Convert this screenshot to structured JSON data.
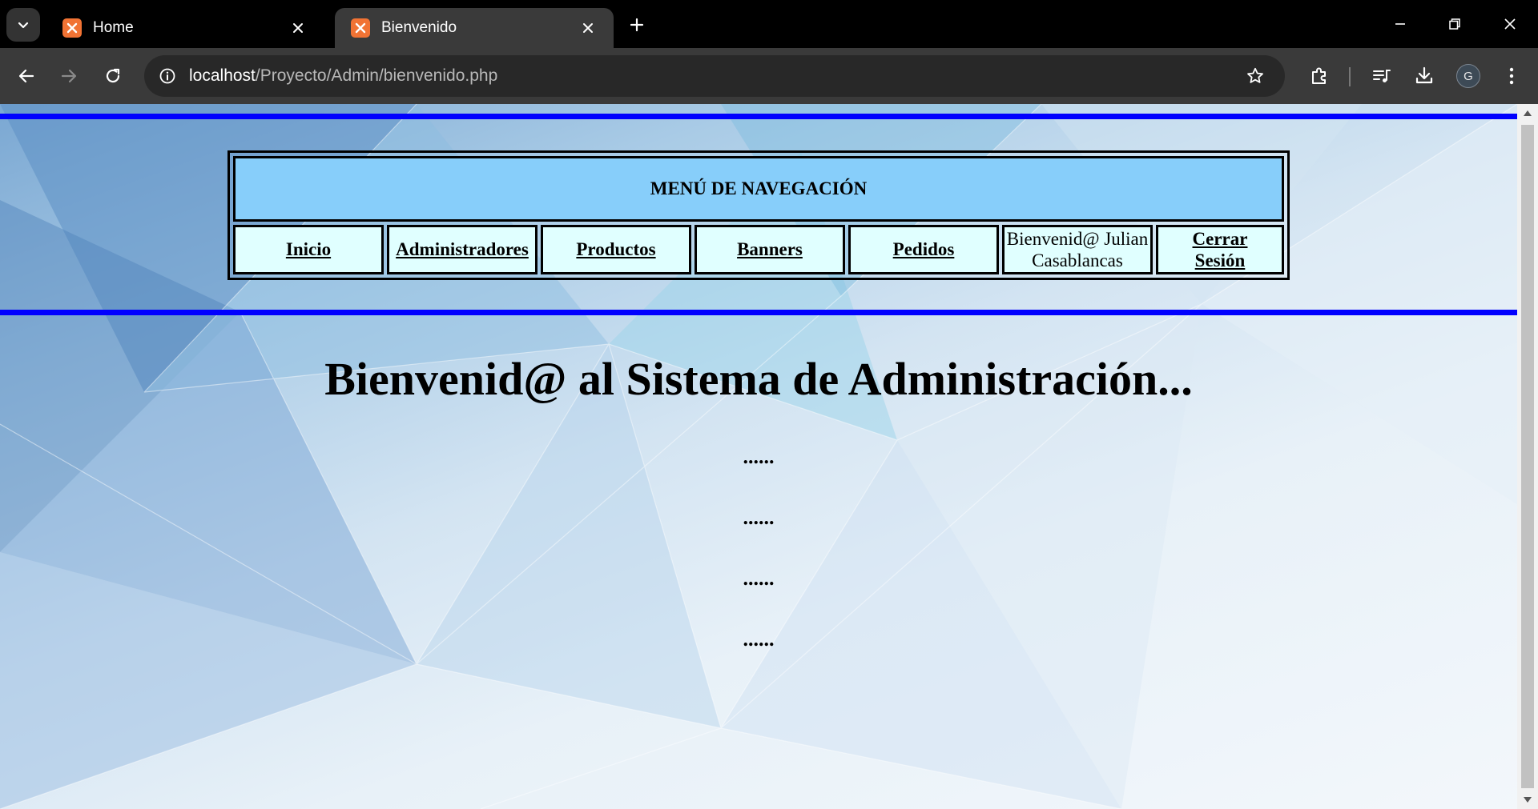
{
  "browser": {
    "tabs": [
      {
        "title": "Home",
        "active": false
      },
      {
        "title": "Bienvenido",
        "active": true
      }
    ],
    "url": {
      "host": "localhost",
      "path": "/Proyecto/Admin/bienvenido.php"
    },
    "profile_initial": "G"
  },
  "menu": {
    "header": "MENÚ DE NAVEGACIÓN",
    "items": [
      {
        "label": "Inicio"
      },
      {
        "label": "Administradores"
      },
      {
        "label": "Productos"
      },
      {
        "label": "Banners"
      },
      {
        "label": "Pedidos"
      }
    ],
    "greeting": "Bienvenid@ Julian Casablancas",
    "logout_line1": "Cerrar",
    "logout_line2": "Sesión"
  },
  "content": {
    "heading": "Bienvenid@ al Sistema de Administración...",
    "dots": [
      "......",
      "......",
      "......",
      "......"
    ]
  },
  "colors": {
    "rule": "#0000ff",
    "menu_header_bg": "#87cefa",
    "menu_cell_bg": "#e0ffff"
  }
}
